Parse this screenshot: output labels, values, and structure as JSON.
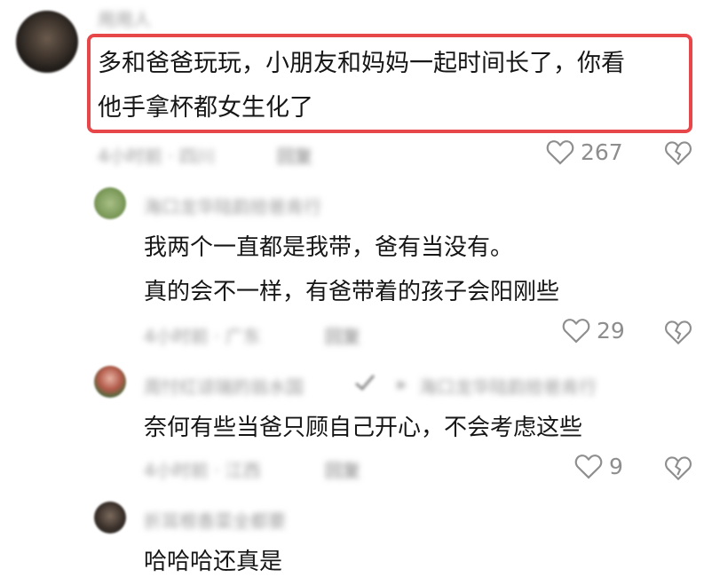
{
  "comments": [
    {
      "author": "用用人",
      "text_lines": [
        "多和爸爸玩玩，小朋友和妈妈一起时间长了，你看",
        "他手拿杯都女生化了"
      ],
      "meta": "4小时前 · 四川",
      "reply_label": "回复",
      "likes": "267"
    },
    {
      "author": "海口龙华陆韵拾爸肯行",
      "text_lines": [
        "我两个一直都是我带，爸有当没有。",
        "真的会不一样，有爸带着的孩子会阳刚些"
      ],
      "meta": "4小时前 · 广东",
      "reply_label": "回复",
      "likes": "29"
    },
    {
      "author": "周忖红谅瑞的翁水国",
      "reply_to": "海口龙华陆韵拾爸肯行",
      "text_lines": [
        "奈何有些当爸只顾自己开心，不会考虑这些"
      ],
      "meta": "4小时前 · 江西",
      "reply_label": "回复",
      "likes": "9"
    },
    {
      "author": "折耳根香菜全都要",
      "text_lines": [
        "哈哈哈还真是"
      ]
    }
  ]
}
